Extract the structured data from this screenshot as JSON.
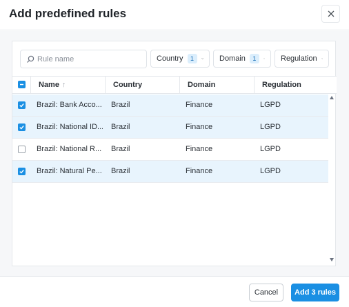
{
  "dialog": {
    "title": "Add predefined rules"
  },
  "search": {
    "placeholder": "Rule name"
  },
  "filters": [
    {
      "label": "Country",
      "badge": "1"
    },
    {
      "label": "Domain",
      "badge": "1"
    },
    {
      "label": "Regulation",
      "badge": ""
    }
  ],
  "table": {
    "columns": [
      "Name",
      "Country",
      "Domain",
      "Regulation"
    ],
    "sort_indicator": "↑",
    "rows": [
      {
        "name": "Brazil: Bank Acco...",
        "country": "Brazil",
        "domain": "Finance",
        "regulation": "LGPD",
        "checked": true
      },
      {
        "name": "Brazil: National ID...",
        "country": "Brazil",
        "domain": "Finance",
        "regulation": "LGPD",
        "checked": true
      },
      {
        "name": "Brazil: National R...",
        "country": "Brazil",
        "domain": "Finance",
        "regulation": "LGPD",
        "checked": false
      },
      {
        "name": "Brazil: Natural Pe...",
        "country": "Brazil",
        "domain": "Finance",
        "regulation": "LGPD",
        "checked": true
      }
    ]
  },
  "footer": {
    "cancel_label": "Cancel",
    "add_label": "Add 3 rules"
  },
  "colors": {
    "accent": "#1a8fe3",
    "selected_row": "#e8f4fd",
    "badge_bg": "#dbeefc"
  }
}
